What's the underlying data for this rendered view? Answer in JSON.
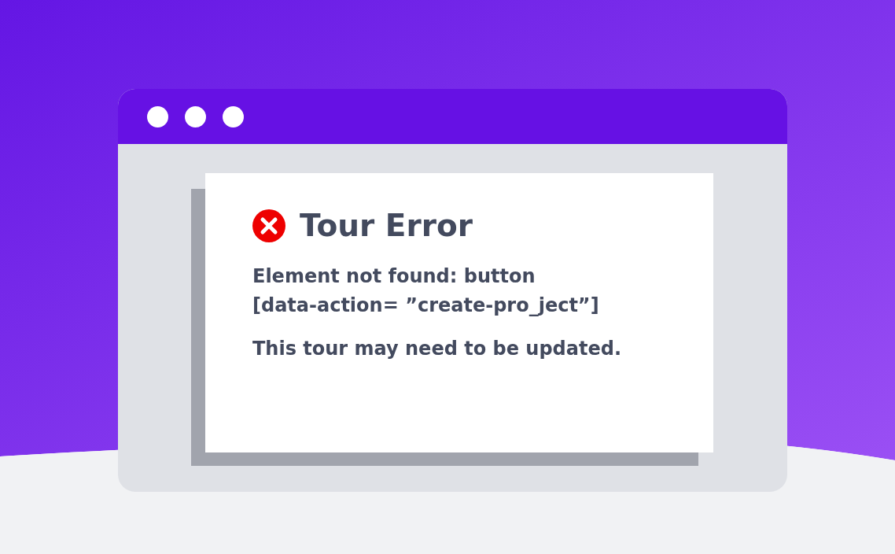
{
  "dialog": {
    "kind": "error",
    "title": "Tour Error",
    "message_lines": [
      "Element not found: button",
      "[data-action= ”create-pro_ject”]"
    ],
    "note": "This tour may need to be updated."
  }
}
